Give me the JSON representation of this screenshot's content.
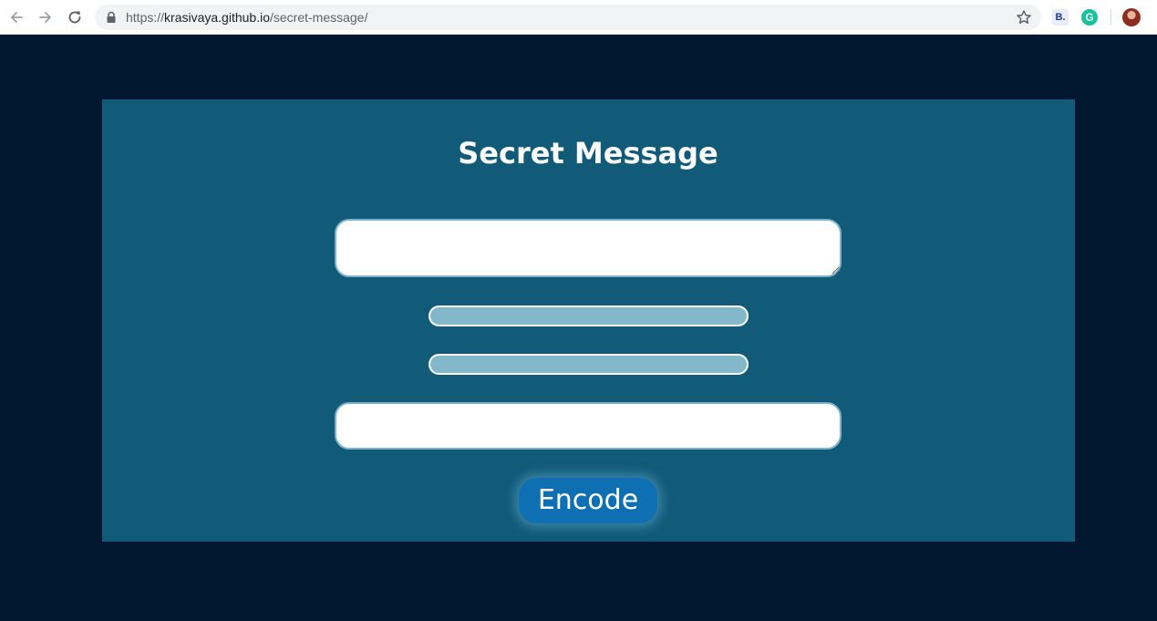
{
  "browser": {
    "url_scheme": "https://",
    "url_host": "krasivaya.github.io",
    "url_path": "/secret-message/",
    "extensions": [
      {
        "name": "bitwarden-like-extension",
        "glyph": "B."
      },
      {
        "name": "grammarly-extension",
        "glyph": "G"
      }
    ]
  },
  "page": {
    "title": "Secret Message",
    "message_value": "",
    "key1_value": "",
    "key2_value": "",
    "output_value": "",
    "encode_label": "Encode"
  },
  "colors": {
    "page_background": "#021830",
    "card_background": "#115a78",
    "pill_background": "#83b8cb",
    "button_background": "#0e6fb3"
  }
}
